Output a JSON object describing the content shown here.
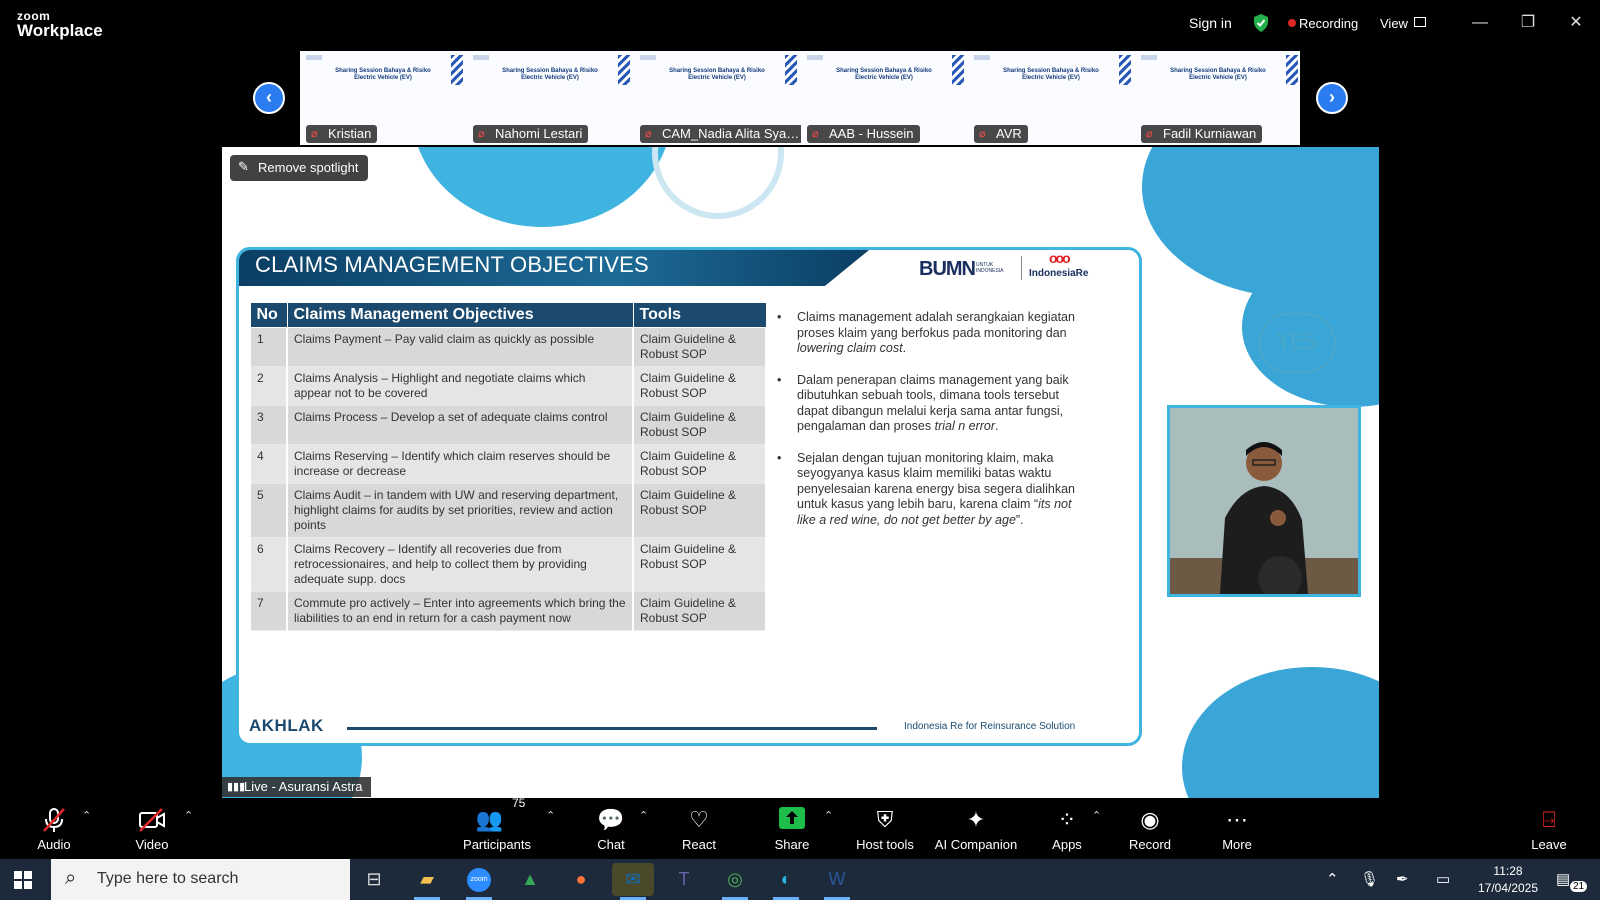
{
  "app": {
    "brand_top": "zoom",
    "brand_bottom": "Workplace",
    "sign_in": "Sign in",
    "recording": "Recording",
    "view": "View"
  },
  "participants_strip": [
    {
      "name": "Kristian",
      "slide_title": "Sharing Session Bahaya & Risiko Electric Vehicle (EV)"
    },
    {
      "name": "Nahomi Lestari",
      "slide_title": "Sharing Session Bahaya & Risiko Electric Vehicle (EV)"
    },
    {
      "name": "CAM_Nadia Alita Syah...",
      "slide_title": "Sharing Session Bahaya & Risiko Electric Vehicle (EV)"
    },
    {
      "name": "AAB - Hussein",
      "slide_title": "Sharing Session Bahaya & Risiko Electric Vehicle (EV)"
    },
    {
      "name": "AVR",
      "slide_title": "Sharing Session Bahaya & Risiko Electric Vehicle (EV)"
    },
    {
      "name": "Fadil Kurniawan",
      "slide_title": "Sharing Session Bahaya & Risiko Electric Vehicle (EV)"
    }
  ],
  "stage": {
    "remove_spotlight": "Remove spotlight",
    "live_label": "Live - Asuransi Astra",
    "yes_doodle": "YES"
  },
  "slide": {
    "title": "CLAIMS MANAGEMENT OBJECTIVES",
    "bumn": "BUMN",
    "bumn_sub": "UNTUK INDONESIA",
    "indonesia_re": "IndonesiaRe",
    "table_headers": [
      "No",
      "Claims Management Objectives",
      "Tools"
    ],
    "rows": [
      {
        "no": "1",
        "objective": "Claims Payment – Pay valid claim as quickly as possible",
        "tools": "Claim Guideline & Robust SOP"
      },
      {
        "no": "2",
        "objective": "Claims Analysis – Highlight and negotiate claims which appear not to be covered",
        "tools": "Claim Guideline & Robust SOP"
      },
      {
        "no": "3",
        "objective": "Claims Process – Develop a set of adequate claims control",
        "tools": "Claim Guideline & Robust SOP"
      },
      {
        "no": "4",
        "objective": "Claims Reserving – Identify which claim reserves should be increase or decrease",
        "tools": "Claim Guideline & Robust SOP"
      },
      {
        "no": "5",
        "objective": "Claims Audit – in tandem with UW and reserving department, highlight claims for audits by set priorities, review and action points",
        "tools": "Claim Guideline & Robust SOP"
      },
      {
        "no": "6",
        "objective": "Claims Recovery – Identify all recoveries due from retrocessionaires, and help to collect them by providing adequate supp. docs",
        "tools": "Claim Guideline & Robust SOP"
      },
      {
        "no": "7",
        "objective": "Commute pro actively – Enter into agreements which bring the liabilities to an end in return for a cash payment now",
        "tools": "Claim Guideline & Robust SOP"
      }
    ],
    "bullets": [
      {
        "text": "Claims management adalah serangkaian kegiatan proses klaim yang berfokus pada monitoring dan ",
        "italic": "lowering claim cost",
        "end": "."
      },
      {
        "text": "Dalam penerapan claims management yang baik dibutuhkan sebuah tools, dimana tools tersebut dapat dibangun melalui kerja sama antar fungsi, pengalaman dan proses ",
        "italic": "trial n error",
        "end": "."
      },
      {
        "text": "Sejalan dengan tujuan monitoring klaim, maka seyogyanya kasus klaim memiliki batas waktu penyelesaian karena energy bisa segera dialihkan untuk kasus yang lebih baru, karena claim “",
        "italic": "its not like a red wine, do not get better by age",
        "end": "”."
      }
    ],
    "footer_left": "AKHLAK",
    "footer_right": "Indonesia Re for Reinsurance Solution"
  },
  "toolbar": {
    "audio": "Audio",
    "video": "Video",
    "participants": "Participants",
    "participants_count": "75",
    "chat": "Chat",
    "react": "React",
    "share": "Share",
    "host_tools": "Host tools",
    "ai_companion": "AI Companion",
    "apps": "Apps",
    "record": "Record",
    "more": "More",
    "leave": "Leave"
  },
  "taskbar": {
    "search_placeholder": "Type here to search",
    "time": "11:28",
    "date": "17/04/2025",
    "notifications": "21"
  },
  "colors": {
    "accent": "#2a7cf0",
    "slide_header": "#1b4a6e",
    "slide_border": "#3fb4e0",
    "share_green": "#1fbd4c",
    "recording_red": "#e02828"
  }
}
